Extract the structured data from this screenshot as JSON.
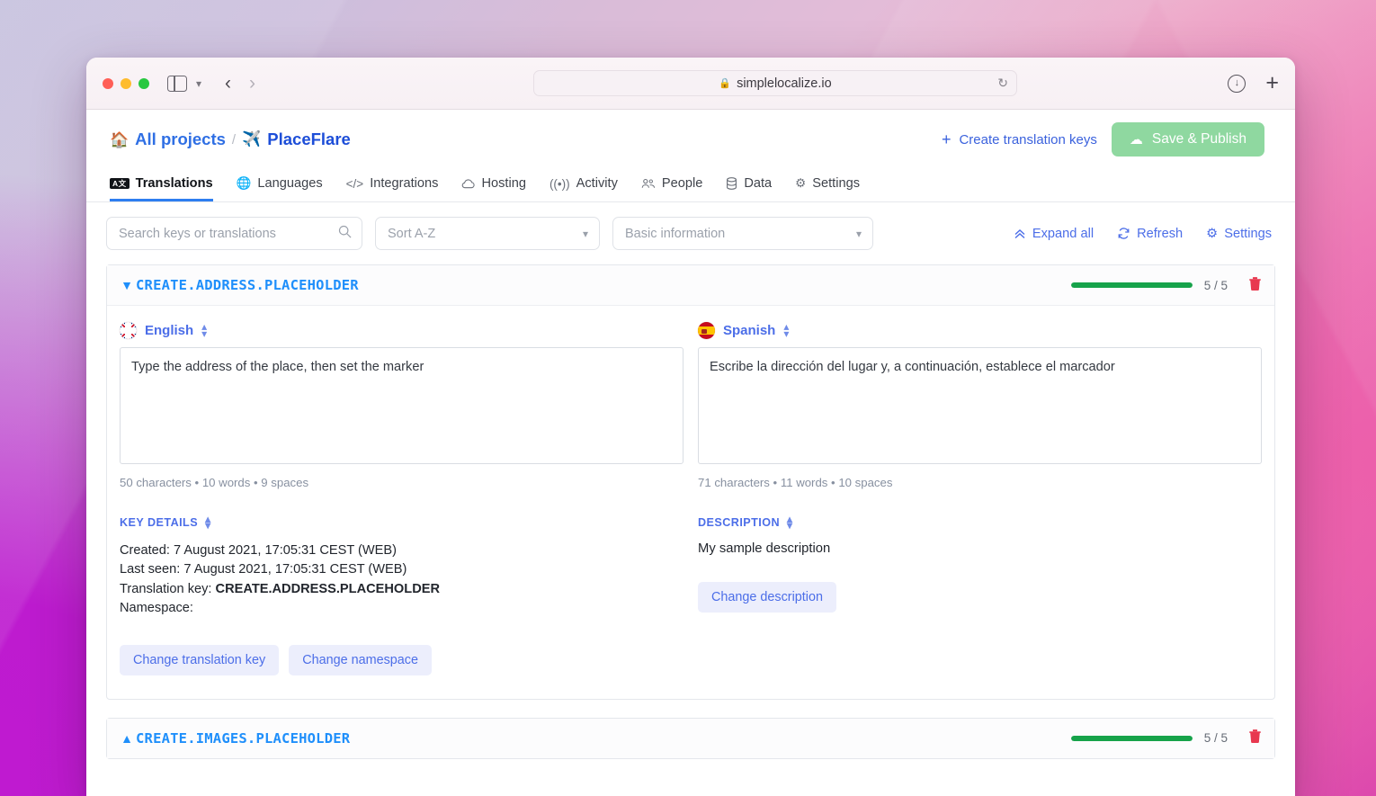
{
  "browser": {
    "url_host": "simplelocalize.io",
    "lock_icon": "lock-icon",
    "reload_icon": "reload-icon",
    "back_icon": "back-arrow-icon",
    "forward_icon": "forward-arrow-icon",
    "sidebar_icon": "sidebar-toggle-icon",
    "downloads_icon": "downloads-icon",
    "new_tab_icon": "plus-icon"
  },
  "header": {
    "home_icon": "home-icon",
    "all_projects": "All projects",
    "separator": "/",
    "project_emoji": "✈️",
    "project_name": "PlaceFlare",
    "create_keys_label": "Create translation keys",
    "create_keys_plus": "+",
    "save_publish_label": "Save & Publish",
    "save_publish_color": "#8fd8a0"
  },
  "tabs": [
    {
      "label": "Translations",
      "icon": "ab-translate-icon",
      "active": true
    },
    {
      "label": "Languages",
      "icon": "globe-icon",
      "active": false
    },
    {
      "label": "Integrations",
      "icon": "code-brackets-icon",
      "active": false
    },
    {
      "label": "Hosting",
      "icon": "cloud-icon",
      "active": false
    },
    {
      "label": "Activity",
      "icon": "broadcast-icon",
      "active": false
    },
    {
      "label": "People",
      "icon": "people-icon",
      "active": false
    },
    {
      "label": "Data",
      "icon": "database-icon",
      "active": false
    },
    {
      "label": "Settings",
      "icon": "gear-icon",
      "active": false
    }
  ],
  "toolbar": {
    "search_placeholder": "Search keys or translations",
    "search_value": "",
    "sort_value": "Sort A-Z",
    "info_value": "Basic information",
    "expand_all": "Expand all",
    "refresh": "Refresh",
    "settings": "Settings"
  },
  "keys": [
    {
      "name": "CREATE.ADDRESS.PLACEHOLDER",
      "expanded": true,
      "caret": "chevron-down-icon",
      "ratio": "5 / 5",
      "progress_percent": 100,
      "progress_color": "#16a34a",
      "delete_icon": "trash-icon",
      "left": {
        "language": "English",
        "flag": "flag-uk",
        "text": "Type the address of the place, then set the marker",
        "meta": "50 characters • 10 words • 9 spaces",
        "section_title": "KEY DETAILS",
        "details": [
          "Created: 7 August 2021, 17:05:31 CEST (WEB)",
          "Last seen: 7 August 2021, 17:05:31 CEST (WEB)"
        ],
        "translation_key_label": "Translation key:",
        "translation_key_value": "CREATE.ADDRESS.PLACEHOLDER",
        "namespace_label": "Namespace:",
        "namespace_value": "",
        "buttons": [
          "Change translation key",
          "Change namespace"
        ]
      },
      "right": {
        "language": "Spanish",
        "flag": "flag-es",
        "text": "Escribe la dirección del lugar y, a continuación, establece el marcador",
        "meta": "71 characters • 11 words • 10 spaces",
        "section_title": "DESCRIPTION",
        "description": "My sample description",
        "buttons": [
          "Change description"
        ]
      }
    },
    {
      "name": "CREATE.IMAGES.PLACEHOLDER",
      "expanded": false,
      "caret": "chevron-up-icon",
      "ratio": "5 / 5",
      "progress_percent": 100,
      "progress_color": "#16a34a",
      "delete_icon": "trash-icon"
    }
  ]
}
